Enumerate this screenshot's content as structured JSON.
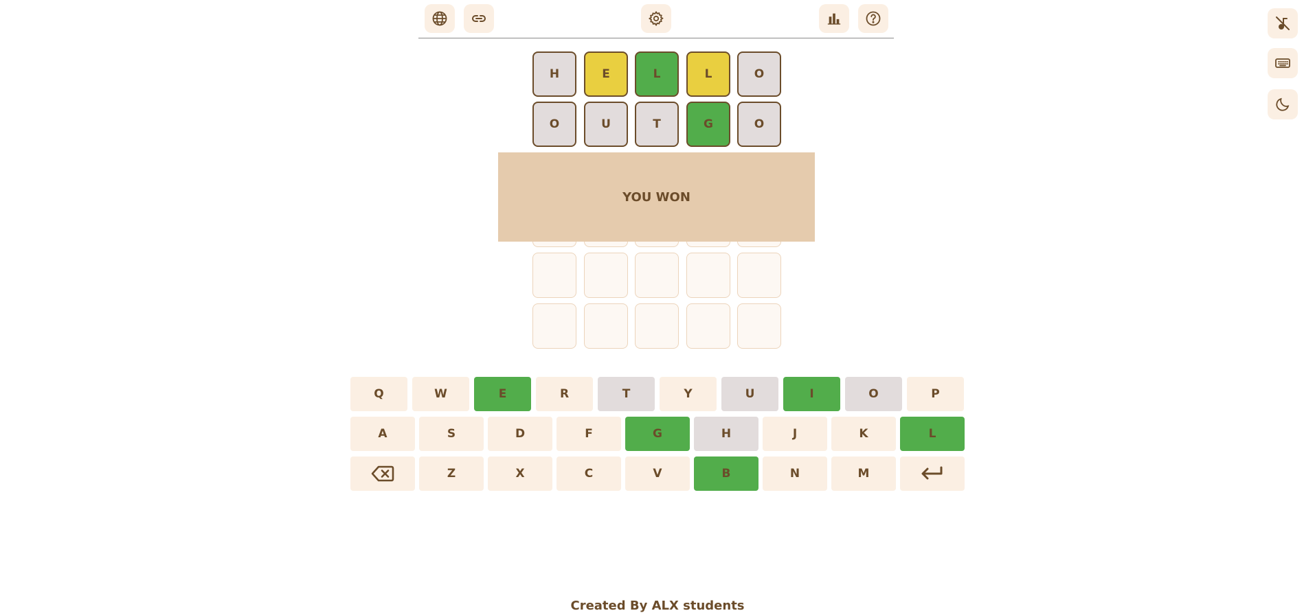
{
  "toolbar": {
    "icons": [
      "globe-icon",
      "link-icon",
      "gear-icon",
      "bar-chart-icon",
      "help-icon"
    ]
  },
  "side": {
    "icons": [
      "mute-music-icon",
      "keyboard-icon",
      "moon-icon"
    ]
  },
  "board": {
    "rows": [
      [
        {
          "letter": "H",
          "state": "absent"
        },
        {
          "letter": "E",
          "state": "present"
        },
        {
          "letter": "L",
          "state": "correct"
        },
        {
          "letter": "L",
          "state": "present"
        },
        {
          "letter": "O",
          "state": "absent"
        }
      ],
      [
        {
          "letter": "O",
          "state": "absent"
        },
        {
          "letter": "U",
          "state": "absent"
        },
        {
          "letter": "T",
          "state": "absent"
        },
        {
          "letter": "G",
          "state": "correct"
        },
        {
          "letter": "O",
          "state": "absent"
        }
      ]
    ]
  },
  "modal": {
    "message": "YOU WON"
  },
  "keyboard": {
    "row1": [
      {
        "label": "Q",
        "state": "unused"
      },
      {
        "label": "W",
        "state": "unused"
      },
      {
        "label": "E",
        "state": "correct"
      },
      {
        "label": "R",
        "state": "unused"
      },
      {
        "label": "T",
        "state": "absent"
      },
      {
        "label": "Y",
        "state": "unused"
      },
      {
        "label": "U",
        "state": "absent"
      },
      {
        "label": "I",
        "state": "correct"
      },
      {
        "label": "O",
        "state": "absent"
      },
      {
        "label": "P",
        "state": "unused"
      }
    ],
    "row2": [
      {
        "label": "A",
        "state": "unused"
      },
      {
        "label": "S",
        "state": "unused"
      },
      {
        "label": "D",
        "state": "unused"
      },
      {
        "label": "F",
        "state": "unused"
      },
      {
        "label": "G",
        "state": "correct"
      },
      {
        "label": "H",
        "state": "absent"
      },
      {
        "label": "J",
        "state": "unused"
      },
      {
        "label": "K",
        "state": "unused"
      },
      {
        "label": "L",
        "state": "correct"
      }
    ],
    "row3": [
      {
        "label": "Z",
        "state": "unused"
      },
      {
        "label": "X",
        "state": "unused"
      },
      {
        "label": "C",
        "state": "unused"
      },
      {
        "label": "V",
        "state": "unused"
      },
      {
        "label": "B",
        "state": "correct"
      },
      {
        "label": "N",
        "state": "unused"
      },
      {
        "label": "M",
        "state": "unused"
      }
    ],
    "backspace_icon": "backspace-icon",
    "enter_icon": "enter-icon"
  },
  "footer": {
    "text": "Created By ALX students"
  },
  "colors": {
    "correct": "#52ad4b",
    "present": "#e9cf40",
    "absent": "#e2dcdc",
    "key_bg": "#fbefe3",
    "text": "#6b4c2a",
    "modal_bg": "#e5cbad"
  }
}
